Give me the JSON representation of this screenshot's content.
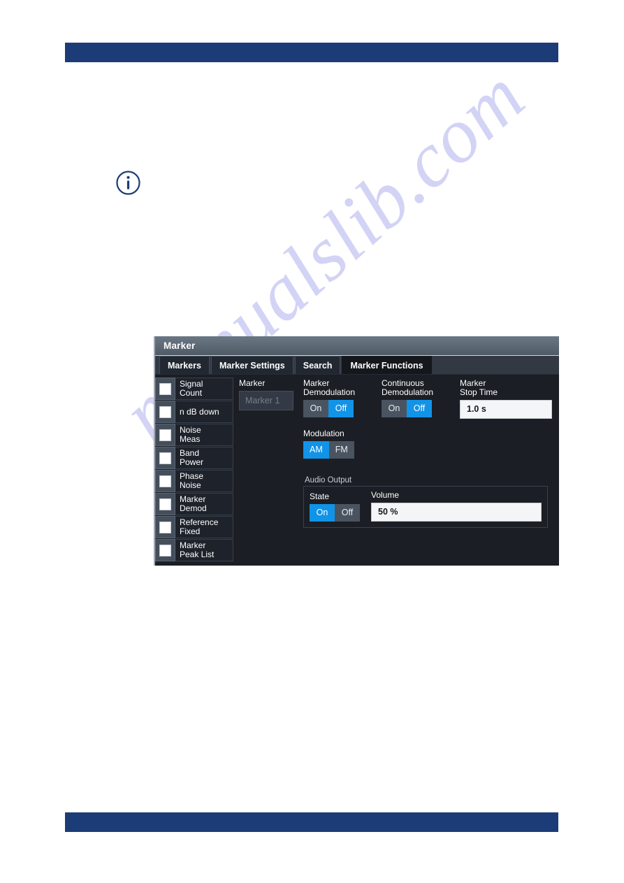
{
  "page": {
    "watermark_text": "manualslib.com",
    "info_icon": "info-circle-icon",
    "accent_blue": "#1193e8",
    "header_blue": "#1c3c77"
  },
  "dialog": {
    "title": "Marker",
    "tabs": [
      {
        "label": "Markers",
        "active": false
      },
      {
        "label": "Marker Settings",
        "active": false
      },
      {
        "label": "Search",
        "active": false
      },
      {
        "label": "Marker Functions",
        "active": true
      }
    ],
    "functions_list": [
      {
        "line1": "Signal",
        "line2": "Count",
        "checked": false
      },
      {
        "line1": "n dB down",
        "line2": "",
        "checked": false
      },
      {
        "line1": "Noise",
        "line2": "Meas",
        "checked": false
      },
      {
        "line1": "Band",
        "line2": "Power",
        "checked": false
      },
      {
        "line1": "Phase",
        "line2": "Noise",
        "checked": false
      },
      {
        "line1": "Marker",
        "line2": "Demod",
        "checked": false
      },
      {
        "line1": "Reference",
        "line2": "Fixed",
        "checked": false
      },
      {
        "line1": "Marker",
        "line2": "Peak List",
        "checked": false
      }
    ],
    "marker": {
      "label": "Marker",
      "selected": "Marker 1",
      "enabled": false
    },
    "marker_demodulation": {
      "label_line1": "Marker",
      "label_line2": "Demodulation",
      "on_label": "On",
      "off_label": "Off",
      "value": "Off"
    },
    "continuous_demodulation": {
      "label_line1": "Continuous",
      "label_line2": "Demodulation",
      "on_label": "On",
      "off_label": "Off",
      "value": "Off"
    },
    "marker_stop_time": {
      "label_line1": "Marker",
      "label_line2": "Stop Time",
      "value": "1.0 s"
    },
    "modulation": {
      "label": "Modulation",
      "am_label": "AM",
      "fm_label": "FM",
      "value": "AM"
    },
    "audio_output": {
      "group_label": "Audio Output",
      "state": {
        "label": "State",
        "on_label": "On",
        "off_label": "Off",
        "value": "On"
      },
      "volume": {
        "label": "Volume",
        "value": "50 %"
      }
    }
  }
}
